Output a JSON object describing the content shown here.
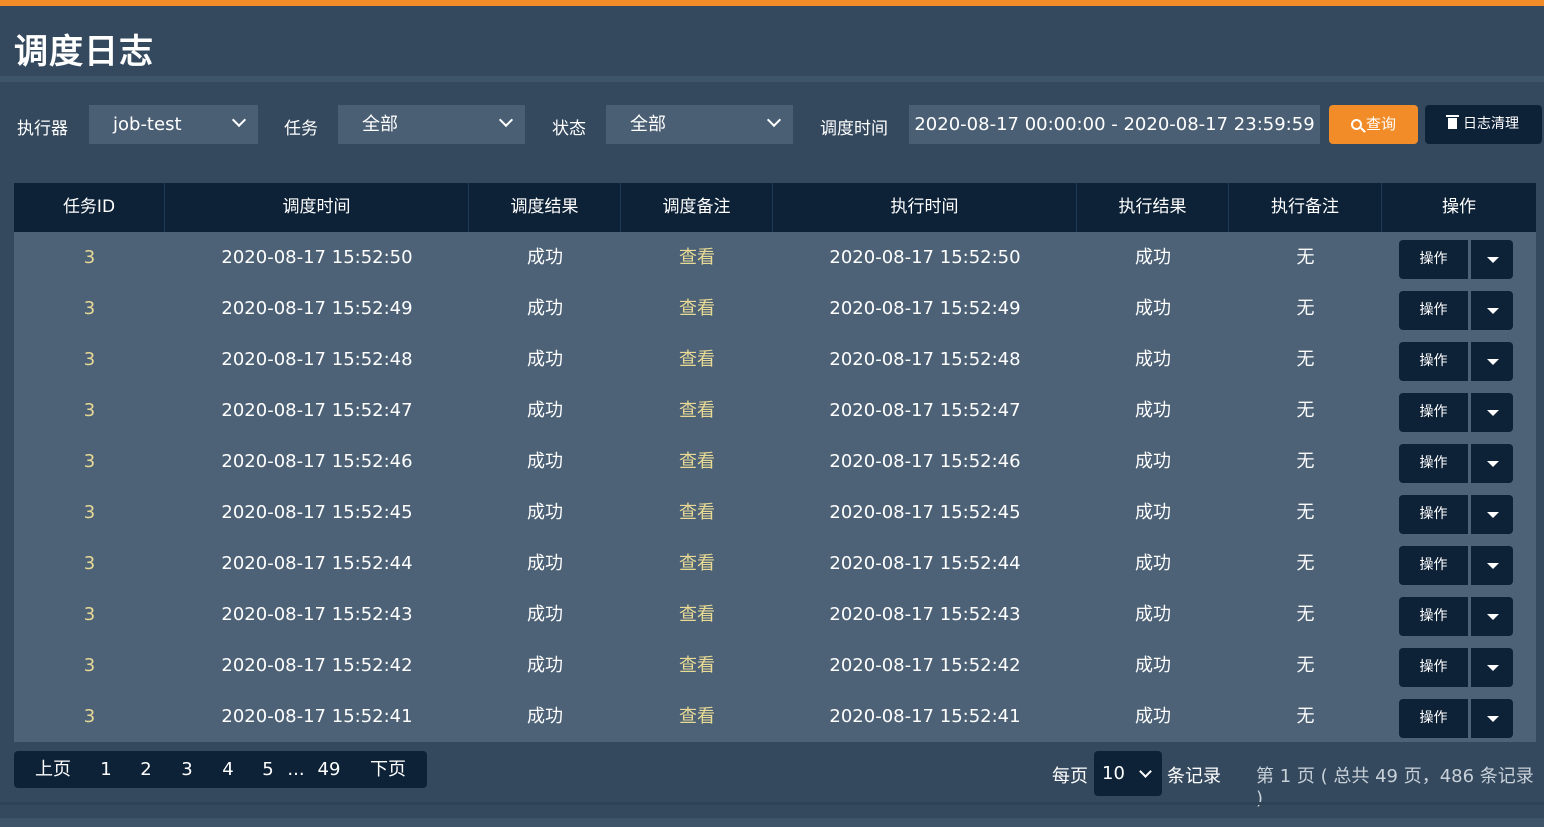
{
  "page": {
    "title": "调度日志"
  },
  "colors": {
    "accent": "#f28c28",
    "dark": "#0d2137",
    "panel": "#34495e",
    "row": "#4d6277",
    "highlight": "#e8d994"
  },
  "filters": {
    "executor_label": "执行器",
    "executor_value": "job-test",
    "task_label": "任务",
    "task_value": "全部",
    "status_label": "状态",
    "status_value": "全部",
    "time_label": "调度时间",
    "time_value": "2020-08-17 00:00:00 - 2020-08-17 23:59:59",
    "search_label": "查询",
    "search_icon": "search-icon",
    "clear_label": "日志清理",
    "clear_icon": "trash-icon"
  },
  "table": {
    "headers": [
      "任务ID",
      "调度时间",
      "调度结果",
      "调度备注",
      "执行时间",
      "执行结果",
      "执行备注",
      "操作"
    ],
    "rows": [
      {
        "id": "3",
        "trigger_time": "2020-08-17 15:52:50",
        "trigger_result": "成功",
        "trigger_msg": "查看",
        "handle_time": "2020-08-17 15:52:50",
        "handle_result": "成功",
        "handle_msg": "无",
        "op": "操作"
      },
      {
        "id": "3",
        "trigger_time": "2020-08-17 15:52:49",
        "trigger_result": "成功",
        "trigger_msg": "查看",
        "handle_time": "2020-08-17 15:52:49",
        "handle_result": "成功",
        "handle_msg": "无",
        "op": "操作"
      },
      {
        "id": "3",
        "trigger_time": "2020-08-17 15:52:48",
        "trigger_result": "成功",
        "trigger_msg": "查看",
        "handle_time": "2020-08-17 15:52:48",
        "handle_result": "成功",
        "handle_msg": "无",
        "op": "操作"
      },
      {
        "id": "3",
        "trigger_time": "2020-08-17 15:52:47",
        "trigger_result": "成功",
        "trigger_msg": "查看",
        "handle_time": "2020-08-17 15:52:47",
        "handle_result": "成功",
        "handle_msg": "无",
        "op": "操作"
      },
      {
        "id": "3",
        "trigger_time": "2020-08-17 15:52:46",
        "trigger_result": "成功",
        "trigger_msg": "查看",
        "handle_time": "2020-08-17 15:52:46",
        "handle_result": "成功",
        "handle_msg": "无",
        "op": "操作"
      },
      {
        "id": "3",
        "trigger_time": "2020-08-17 15:52:45",
        "trigger_result": "成功",
        "trigger_msg": "查看",
        "handle_time": "2020-08-17 15:52:45",
        "handle_result": "成功",
        "handle_msg": "无",
        "op": "操作"
      },
      {
        "id": "3",
        "trigger_time": "2020-08-17 15:52:44",
        "trigger_result": "成功",
        "trigger_msg": "查看",
        "handle_time": "2020-08-17 15:52:44",
        "handle_result": "成功",
        "handle_msg": "无",
        "op": "操作"
      },
      {
        "id": "3",
        "trigger_time": "2020-08-17 15:52:43",
        "trigger_result": "成功",
        "trigger_msg": "查看",
        "handle_time": "2020-08-17 15:52:43",
        "handle_result": "成功",
        "handle_msg": "无",
        "op": "操作"
      },
      {
        "id": "3",
        "trigger_time": "2020-08-17 15:52:42",
        "trigger_result": "成功",
        "trigger_msg": "查看",
        "handle_time": "2020-08-17 15:52:42",
        "handle_result": "成功",
        "handle_msg": "无",
        "op": "操作"
      },
      {
        "id": "3",
        "trigger_time": "2020-08-17 15:52:41",
        "trigger_result": "成功",
        "trigger_msg": "查看",
        "handle_time": "2020-08-17 15:52:41",
        "handle_result": "成功",
        "handle_msg": "无",
        "op": "操作"
      }
    ]
  },
  "pagination": {
    "prev": "上页",
    "pages": [
      "1",
      "2",
      "3",
      "4",
      "5"
    ],
    "ellipsis": "...",
    "last": "49",
    "next": "下页",
    "per_page_prefix": "每页",
    "per_page_value": "10",
    "per_page_suffix": "条记录",
    "info": "第 1 页 ( 总共 49 页，486 条记录 )"
  }
}
